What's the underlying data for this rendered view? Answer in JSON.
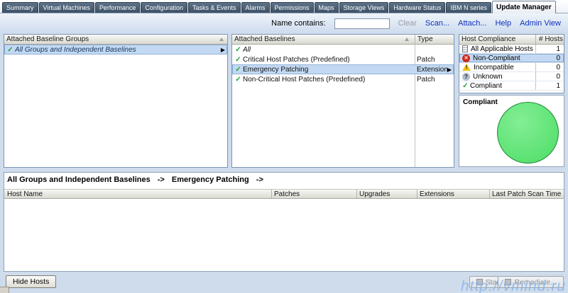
{
  "tabs": [
    {
      "label": "Summary",
      "active": false
    },
    {
      "label": "Virtual Machines",
      "active": false
    },
    {
      "label": "Performance",
      "active": false
    },
    {
      "label": "Configuration",
      "active": false
    },
    {
      "label": "Tasks & Events",
      "active": false
    },
    {
      "label": "Alarms",
      "active": false
    },
    {
      "label": "Permissions",
      "active": false
    },
    {
      "label": "Maps",
      "active": false
    },
    {
      "label": "Storage Views",
      "active": false
    },
    {
      "label": "Hardware Status",
      "active": false
    },
    {
      "label": "IBM N series",
      "active": false
    },
    {
      "label": "Update Manager",
      "active": true
    }
  ],
  "toolbar": {
    "name_contains_label": "Name contains:",
    "name_input_value": "",
    "clear_label": "Clear",
    "scan_label": "Scan...",
    "attach_label": "Attach...",
    "help_label": "Help",
    "admin_view_label": "Admin View"
  },
  "baseline_groups": {
    "header": "Attached Baseline Groups",
    "rows": [
      {
        "label": "All Groups and Independent Baselines",
        "selected": true
      }
    ]
  },
  "attached_baselines": {
    "header": "Attached Baselines",
    "type_header": "Type",
    "rows": [
      {
        "label": "All",
        "type": "",
        "italic": true,
        "selected": false
      },
      {
        "label": "Critical Host Patches (Predefined)",
        "type": "Patch",
        "italic": false,
        "selected": false
      },
      {
        "label": "Emergency Patching",
        "type": "Extension",
        "italic": false,
        "selected": true
      },
      {
        "label": "Non-Critical Host Patches (Predefined)",
        "type": "Patch",
        "italic": false,
        "selected": false
      }
    ]
  },
  "host_compliance": {
    "header": "Host Compliance",
    "hosts_header": "# Hosts",
    "rows": [
      {
        "label": "All Applicable Hosts",
        "count": "1",
        "icon": "report-icon",
        "selected": false
      },
      {
        "label": "Non-Compliant",
        "count": "0",
        "icon": "error-icon",
        "selected": true
      },
      {
        "label": "Incompatible",
        "count": "0",
        "icon": "warning-icon",
        "selected": false
      },
      {
        "label": "Unknown",
        "count": "0",
        "icon": "question-icon",
        "selected": false
      },
      {
        "label": "Compliant",
        "count": "1",
        "icon": "check-icon",
        "selected": false
      }
    ],
    "chart": {
      "label": "Compliant",
      "type": "pie",
      "slices": [
        {
          "label": "Compliant",
          "value": 1,
          "percent": 100
        }
      ],
      "color": "#5ae46f"
    }
  },
  "hosts_table": {
    "breadcrumb": [
      "All Groups and Independent Baselines",
      "->",
      "Emergency Patching",
      "->"
    ],
    "columns": [
      "Host Name",
      "Patches",
      "Upgrades",
      "Extensions",
      "Last Patch Scan Time"
    ],
    "rows": []
  },
  "footer": {
    "hide_hosts_label": "Hide Hosts",
    "stage_label": "Stage...",
    "remediate_label": "Remediate..."
  },
  "icons": {
    "check": "✓",
    "row_arrow": "▶",
    "error_mark": "✕",
    "warning_mark": "!",
    "question_mark": "?"
  },
  "colors": {
    "selection": "#c3d9f3",
    "link": "#0d2fbf",
    "compliant_green": "#5ae46f",
    "error_red": "#cf291d",
    "warning_yellow": "#f2c00e"
  },
  "watermark": "http://vmind.ru"
}
